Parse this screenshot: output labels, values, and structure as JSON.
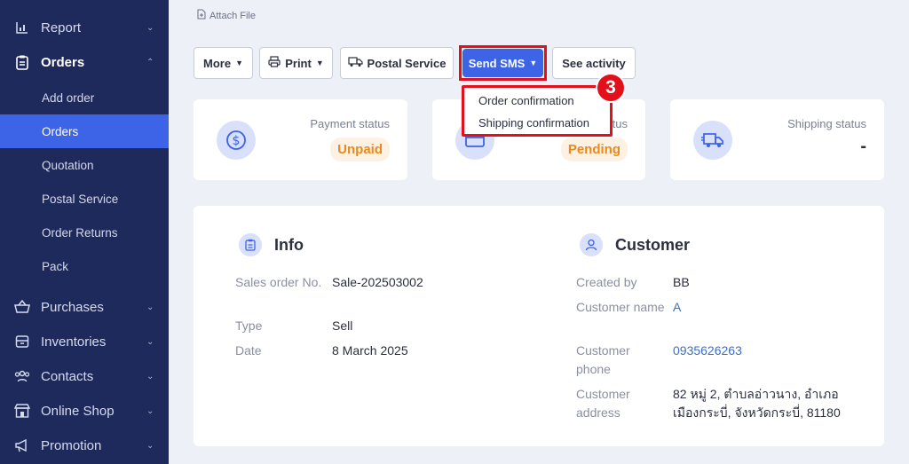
{
  "sidebar": {
    "report": "Report",
    "orders": "Orders",
    "sub": [
      "Add order",
      "Orders",
      "Quotation",
      "Postal Service",
      "Order Returns",
      "Pack"
    ],
    "purchases": "Purchases",
    "inventories": "Inventories",
    "contacts": "Contacts",
    "online_shop": "Online Shop",
    "promotion": "Promotion"
  },
  "attach_file": "Attach File",
  "toolbar": {
    "more": "More",
    "print": "Print",
    "postal": "Postal Service",
    "send_sms": "Send SMS",
    "see_activity": "See activity"
  },
  "sms_menu": {
    "order_confirmation": "Order confirmation",
    "shipping_confirmation": "Shipping confirmation"
  },
  "step_badge": "3",
  "cards": {
    "payment": {
      "title": "Payment status",
      "value": "Unpaid"
    },
    "middle": {
      "title": "tus",
      "value": "Pending"
    },
    "shipping": {
      "title": "Shipping status",
      "value": "-"
    }
  },
  "info": {
    "title": "Info",
    "sales_order_label": "Sales order No.",
    "sales_order_value": "Sale-202503002",
    "type_label": "Type",
    "type_value": "Sell",
    "date_label": "Date",
    "date_value": "8 March 2025"
  },
  "customer": {
    "title": "Customer",
    "created_by_label": "Created by",
    "created_by_value": "BB",
    "name_label": "Customer name",
    "name_value": "A",
    "phone_label": "Customer phone",
    "phone_value": "0935626263",
    "address_label": "Customer address",
    "address_line1": "82 หมู่ 2, ตำบลอ่าวนาง, อำเภอ",
    "address_line2": "เมืองกระบี่, จังหวัดกระบี่, 81180"
  },
  "colors": {
    "sidebar": "#1f2a5c",
    "accent": "#3d63e6",
    "highlight": "#e3101c",
    "warning": "#e88a1d"
  }
}
